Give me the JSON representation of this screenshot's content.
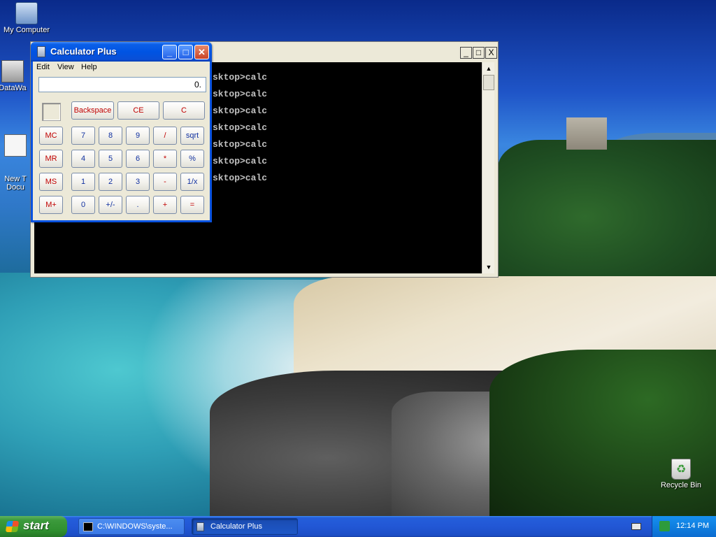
{
  "desktop": {
    "icons": [
      {
        "label": "My Computer"
      },
      {
        "label": "DataWa"
      },
      {
        "label": "New T\nDocu"
      },
      {
        "label": "Recycle Bin"
      }
    ]
  },
  "console": {
    "title_visible": "",
    "lines": [
      "sktop>calc",
      "sktop>calc",
      "sktop>calc",
      "sktop>calc",
      "sktop>calc",
      "sktop>calc",
      "sktop>calc"
    ],
    "controls": {
      "minimize": "_",
      "maximize": "□",
      "close": "X"
    }
  },
  "calculator": {
    "title": "Calculator Plus",
    "menus": [
      "Edit",
      "View",
      "Help"
    ],
    "display_value": "0.",
    "title_buttons": {
      "minimize": "_",
      "maximize": "□",
      "close": "✕"
    },
    "top_buttons": [
      "Backspace",
      "CE",
      "C"
    ],
    "memory_buttons": [
      "MC",
      "MR",
      "MS",
      "M+"
    ],
    "rows": [
      [
        "7",
        "8",
        "9",
        "/",
        "sqrt"
      ],
      [
        "4",
        "5",
        "6",
        "*",
        "%"
      ],
      [
        "1",
        "2",
        "3",
        "-",
        "1/x"
      ],
      [
        "0",
        "+/-",
        ".",
        "+",
        "="
      ]
    ]
  },
  "taskbar": {
    "start_label": "start",
    "tasks": [
      {
        "label": "C:\\WINDOWS\\syste..."
      },
      {
        "label": "Calculator Plus"
      }
    ],
    "clock": "12:14 PM"
  }
}
